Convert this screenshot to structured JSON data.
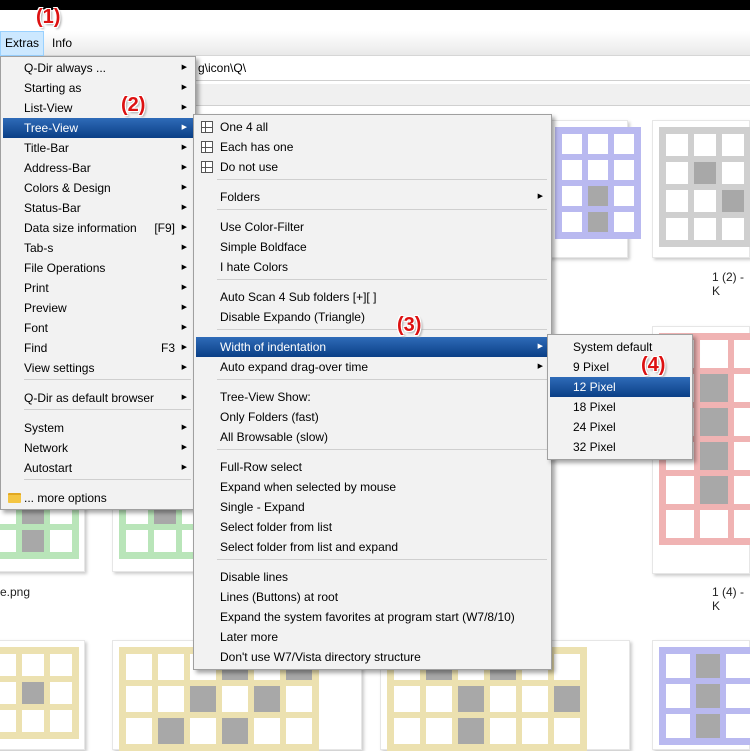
{
  "annotations": [
    "(1)",
    "(2)",
    "(3)",
    "(4)"
  ],
  "menubar": {
    "extras": "Extras",
    "info": "Info"
  },
  "address": {
    "path": "g\\icon\\Q\\"
  },
  "captions": {
    "c1": "1 (2) - K",
    "c2": "e.png",
    "c3": "1 (4) - K"
  },
  "extras_menu": {
    "items": [
      {
        "label": "Q-Dir always ...",
        "shortcut": "",
        "submenu": true
      },
      {
        "label": "Starting as",
        "shortcut": "",
        "submenu": true
      },
      {
        "label": "List-View",
        "shortcut": "",
        "submenu": true
      },
      {
        "label": "Tree-View",
        "shortcut": "",
        "submenu": true
      },
      {
        "label": "Title-Bar",
        "shortcut": "",
        "submenu": true
      },
      {
        "label": "Address-Bar",
        "shortcut": "",
        "submenu": true
      },
      {
        "label": "Colors & Design",
        "shortcut": "",
        "submenu": true
      },
      {
        "label": "Status-Bar",
        "shortcut": "",
        "submenu": true
      },
      {
        "label": "Data size information",
        "shortcut": "[F9]",
        "submenu": true
      },
      {
        "label": "Tab-s",
        "shortcut": "",
        "submenu": true
      },
      {
        "label": "File Operations",
        "shortcut": "",
        "submenu": true
      },
      {
        "label": "Print",
        "shortcut": "",
        "submenu": true
      },
      {
        "label": "Preview",
        "shortcut": "",
        "submenu": true
      },
      {
        "label": "Font",
        "shortcut": "",
        "submenu": true
      },
      {
        "label": "Find",
        "shortcut": "F3",
        "submenu": true
      },
      {
        "label": "View settings",
        "shortcut": "",
        "submenu": true
      },
      {
        "label": "Q-Dir as default browser",
        "shortcut": "",
        "submenu": true
      },
      {
        "label": "System",
        "shortcut": "",
        "submenu": true
      },
      {
        "label": "Network",
        "shortcut": "",
        "submenu": true
      },
      {
        "label": "Autostart",
        "shortcut": "",
        "submenu": true
      },
      {
        "label": "... more options",
        "shortcut": "",
        "submenu": false
      }
    ]
  },
  "treeview_menu": {
    "items": [
      "One 4 all",
      "Each has one",
      "Do not use",
      "Folders",
      "Use Color-Filter",
      "Simple Boldface",
      "I hate Colors",
      "Auto Scan 4 Sub folders  [+][ ]",
      "Disable Expando (Triangle)",
      "Width of indentation",
      "Auto expand drag-over time",
      "Tree-View Show:",
      "Only Folders (fast)",
      "All Browsable (slow)",
      "Full-Row select",
      "Expand when selected by mouse",
      "Single - Expand",
      "Select folder from list",
      "Select folder from list and expand",
      "Disable lines",
      "Lines (Buttons) at root",
      "Expand the system favorites at program start (W7/8/10)",
      "Later more",
      "Don't use W7/Vista directory structure"
    ]
  },
  "indent_menu": {
    "items": [
      "System default",
      "9 Pixel",
      "12 Pixel",
      "18 Pixel",
      "24 Pixel",
      "32 Pixel"
    ],
    "selected": "12 Pixel"
  },
  "colors": {
    "highlight": "#0a3f86",
    "annotation": "#dd1111",
    "tile_purple": "#b9b9f0",
    "tile_gray": "#cfcfcf",
    "tile_red": "#f0b3b3",
    "tile_green": "#b9e5b9",
    "tile_yellow": "#ece1b0",
    "tile_dark": "#a8a8a8"
  }
}
